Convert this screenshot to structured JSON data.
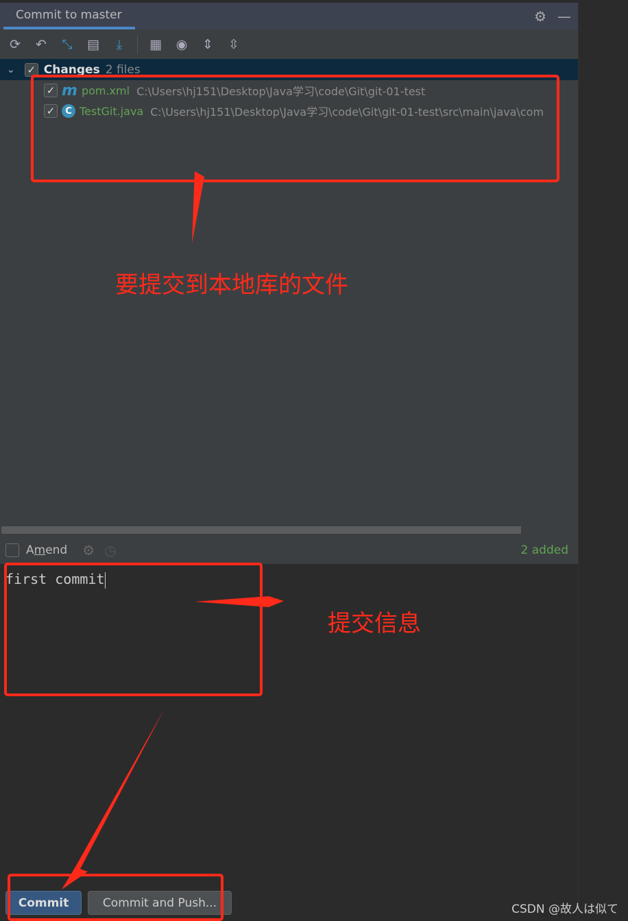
{
  "tab": {
    "title": "Commit to master"
  },
  "toolbar": {
    "icons": [
      "refresh-icon",
      "rollback-icon",
      "diff-icon",
      "changelist-icon",
      "update-icon",
      "group-by-icon",
      "view-options-icon",
      "expand-all-icon",
      "collapse-all-icon"
    ]
  },
  "changes": {
    "label": "Changes",
    "count": "2 files",
    "files": [
      {
        "name": "pom.xml",
        "path": "C:\\Users\\hj151\\Desktop\\Java学习\\code\\Git\\git-01-test",
        "icon": "maven-icon"
      },
      {
        "name": "TestGit.java",
        "path": "C:\\Users\\hj151\\Desktop\\Java学习\\code\\Git\\git-01-test\\src\\main\\java\\com",
        "icon": "java-class-icon"
      }
    ]
  },
  "amend": {
    "label_pre": "A",
    "label_u": "m",
    "label_post": "end",
    "status": "2 added"
  },
  "message": {
    "value": "first commit"
  },
  "buttons": {
    "commit_pre": "Commit",
    "commit": "Commit",
    "commit_push": "Commit and Push..."
  },
  "annotations": {
    "files": "要提交到本地库的文件",
    "message": "提交信息"
  },
  "watermark": "CSDN @故人は似て",
  "colors": {
    "accent": "#4a88c7",
    "added": "#62a356",
    "annotation": "#ff2a1a",
    "selection": "#0d293e"
  }
}
